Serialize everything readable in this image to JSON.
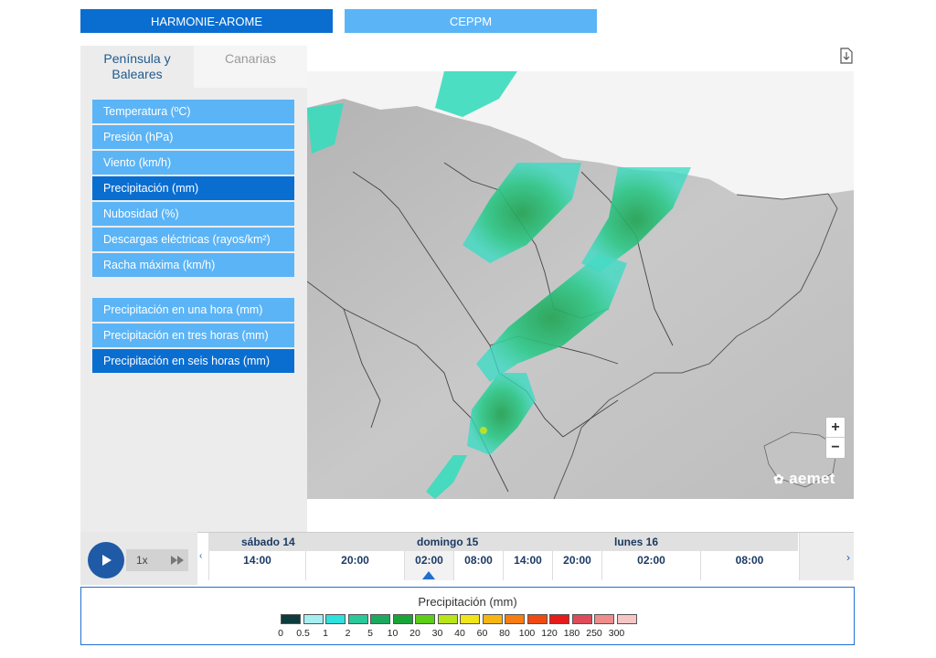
{
  "models": {
    "harmonie": "HARMONIE-AROME",
    "ceppm": "CEPPM"
  },
  "regions": {
    "peninsula": "Península y Baleares",
    "canarias": "Canarias"
  },
  "variables": [
    {
      "label": "Temperatura (ºC)",
      "selected": false
    },
    {
      "label": "Presión (hPa)",
      "selected": false
    },
    {
      "label": "Viento (km/h)",
      "selected": false
    },
    {
      "label": "Precipitación (mm)",
      "selected": true
    },
    {
      "label": "Nubosidad (%)",
      "selected": false
    },
    {
      "label": "Descargas eléctricas (rayos/km²)",
      "selected": false
    },
    {
      "label": "Racha máxima (km/h)",
      "selected": false
    }
  ],
  "sub_variables": [
    {
      "label": "Precipitación en una hora (mm)",
      "selected": false
    },
    {
      "label": "Precipitación en tres horas (mm)",
      "selected": false
    },
    {
      "label": "Precipitación en seis horas (mm)",
      "selected": true
    }
  ],
  "map": {
    "zoom_in": "+",
    "zoom_out": "−",
    "logo": "aemet",
    "icons": [
      "download-icon",
      "zoom-in-icon",
      "zoom-out-icon"
    ]
  },
  "player": {
    "speed": "1x",
    "icons": [
      "play-icon",
      "fast-forward-icon"
    ]
  },
  "timeline": {
    "prev": "‹",
    "next": "›",
    "days": [
      "sábado 14",
      "domingo 15",
      "lunes 16"
    ],
    "hours": [
      "14:00",
      "20:00",
      "02:00",
      "08:00",
      "14:00",
      "20:00",
      "02:00",
      "08:00"
    ],
    "current_index": 2
  },
  "legend": {
    "title": "Precipitación (mm)",
    "labels": [
      "0",
      "0.5",
      "1",
      "2",
      "5",
      "10",
      "20",
      "30",
      "40",
      "60",
      "80",
      "100",
      "120",
      "180",
      "250",
      "300"
    ],
    "colors": [
      "#0e3b3b",
      "#a6eef0",
      "#2fe0dc",
      "#2cc79a",
      "#1ea85f",
      "#19a43a",
      "#5ccd19",
      "#b7e41a",
      "#efe51a",
      "#f5b514",
      "#f57d12",
      "#ee4a12",
      "#e61c1c",
      "#de4b5a",
      "#ee8d8d",
      "#f6c6c6"
    ]
  },
  "colors": {
    "tab_dark": "#0a6ed1",
    "tab_light": "#5bb4f6",
    "accent_text": "#1b3a63",
    "play_button": "#1f5aa6"
  }
}
